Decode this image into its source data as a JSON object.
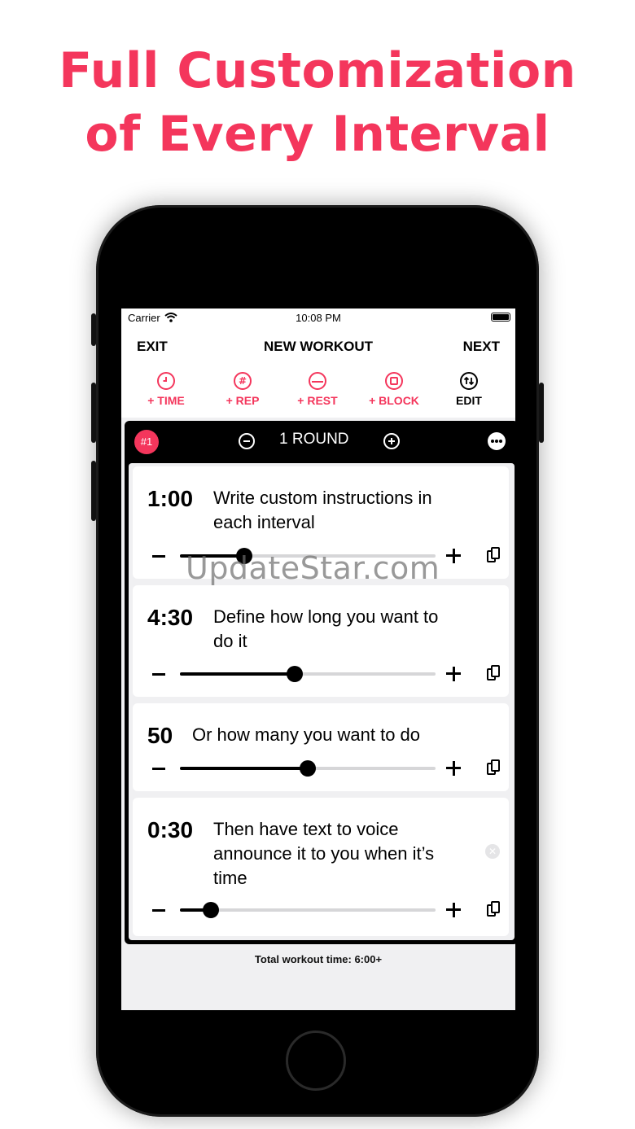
{
  "headline": {
    "line1": "Full Customization",
    "line2": "of Every Interval"
  },
  "status": {
    "carrier": "Carrier",
    "time": "10:08 PM"
  },
  "nav": {
    "left": "EXIT",
    "title": "NEW WORKOUT",
    "right": "NEXT"
  },
  "toolbar": [
    {
      "label": "+ TIME",
      "icon": "clock-icon"
    },
    {
      "label": "+ REP",
      "icon": "hash-icon"
    },
    {
      "label": "+ REST",
      "icon": "rest-icon"
    },
    {
      "label": "+ BLOCK",
      "icon": "block-icon"
    },
    {
      "label": "EDIT",
      "icon": "reorder-icon"
    }
  ],
  "block": {
    "badge": "#1",
    "rounds_label": "1 ROUND"
  },
  "intervals": [
    {
      "value": "1:00",
      "text_line1": "Write custom instructions in",
      "text_line2": "each interval",
      "slider_fraction": 0.25
    },
    {
      "value": "4:30",
      "text_line1": "Define how long you want to",
      "text_line2": "do it",
      "slider_fraction": 0.45
    },
    {
      "value": "50",
      "text_line1": "Or how many you want to do",
      "slider_fraction": 0.5
    },
    {
      "value": "0:30",
      "text_line1": "Then have text to voice",
      "text_line2": "announce it to you when it’s",
      "text_line3": "time",
      "slider_fraction": 0.12
    }
  ],
  "footer": {
    "total": "Total workout time: 6:00+"
  },
  "watermark": "UpdateStar.com",
  "colors": {
    "accent": "#f4365c",
    "dark": "#000000",
    "track": "#d6d6d8"
  }
}
